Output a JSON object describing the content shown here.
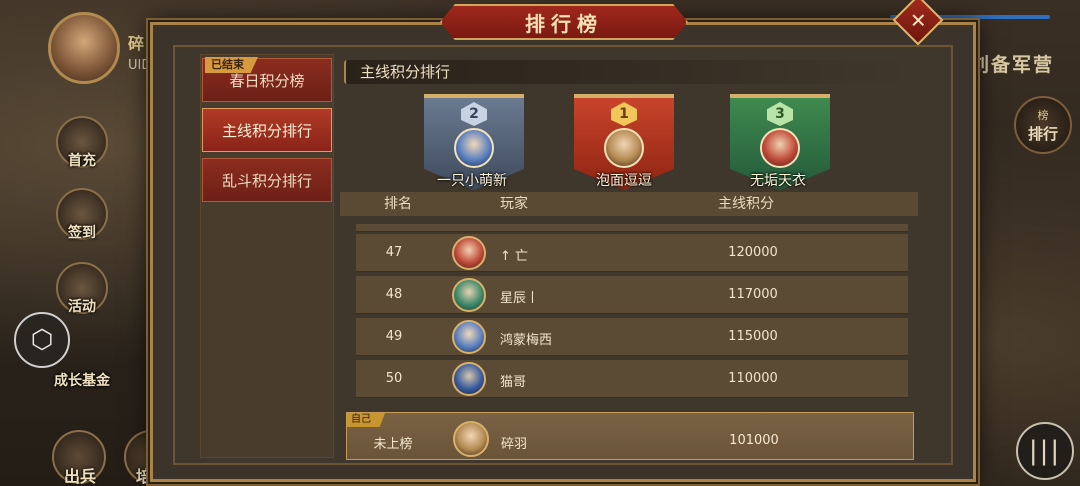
{
  "background": {
    "player_name": "碎羽",
    "uid_label": "UID",
    "camp": "刘备军营",
    "left_buttons": [
      "首充",
      "签到",
      "活动",
      "成长基金"
    ],
    "bottom_buttons": [
      "出兵",
      "培养"
    ],
    "rank_button": {
      "small": "榜",
      "big": "排行"
    }
  },
  "dialog": {
    "title": "排行榜",
    "close_label": "✕"
  },
  "tabs": [
    {
      "label": "春日积分榜",
      "badge": "已结束"
    },
    {
      "label": "主线积分排行"
    },
    {
      "label": "乱斗积分排行"
    }
  ],
  "section_title": "主线积分排行",
  "podium": {
    "first": {
      "rank": "1",
      "name": "泡面逗逗"
    },
    "second": {
      "rank": "2",
      "name": "一只小萌新"
    },
    "third": {
      "rank": "3",
      "name": "无垢天衣"
    }
  },
  "table": {
    "headers": {
      "rank": "排名",
      "player": "玩家",
      "score": "主线积分"
    },
    "rows": [
      {
        "rank": "47",
        "name": "↑ 亡",
        "score": "120000"
      },
      {
        "rank": "48",
        "name": "星辰丨",
        "score": "117000"
      },
      {
        "rank": "49",
        "name": "鸿蒙梅西",
        "score": "115000"
      },
      {
        "rank": "50",
        "name": "猫哥",
        "score": "110000"
      }
    ]
  },
  "self": {
    "tag": "自己",
    "rank": "未上榜",
    "name": "碎羽",
    "score": "101000"
  }
}
